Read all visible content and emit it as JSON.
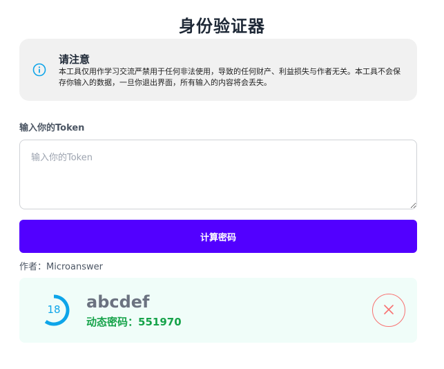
{
  "header": {
    "title": "身份验证器"
  },
  "notice": {
    "icon": "info-icon",
    "title": "请注意",
    "body": "本工具仅用作学习交流严禁用于任何非法使用，导致的任何财产、利益损失与作者无关。本工具不会保存你输入的数据，一旦你退出界面，所有输入的内容将会丢失。"
  },
  "token": {
    "label": "输入你的Token",
    "placeholder": "输入你的Token",
    "value": ""
  },
  "compute": {
    "label": "计算密码"
  },
  "author": {
    "text": "作者：Microanswer"
  },
  "result": {
    "countdown": "18",
    "countdown_fraction": 0.6,
    "account": "abcdef",
    "code_label": "动态密码：",
    "code": "551970",
    "delete_icon": "close-icon"
  },
  "colors": {
    "accent": "#5200ff",
    "info": "#0ea5e9",
    "code": "#16a34a",
    "danger": "#f87171",
    "card_bg": "#f0fdf9",
    "notice_bg": "#f1f1f1"
  }
}
